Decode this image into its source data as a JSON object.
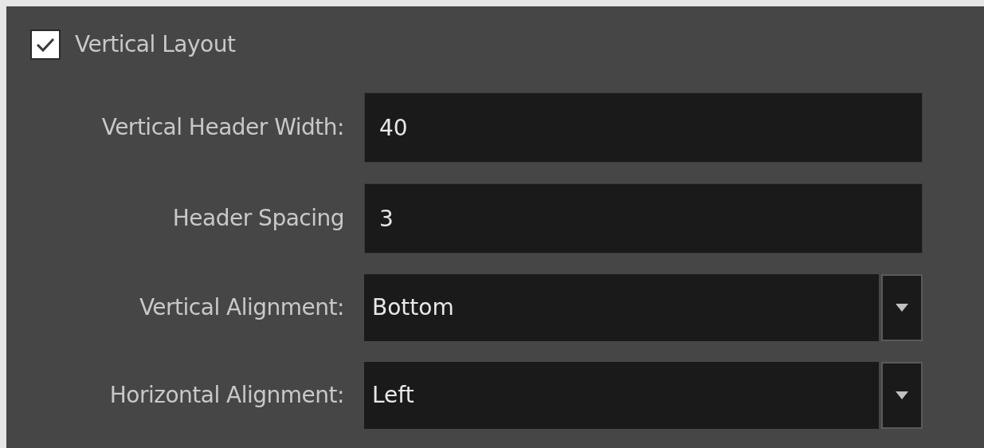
{
  "vertical_layout": {
    "label": "Vertical Layout",
    "checked": true
  },
  "fields": [
    {
      "kind": "text",
      "label": "Vertical Header Width:",
      "value": "40"
    },
    {
      "kind": "text",
      "label": "Header Spacing",
      "value": "3"
    },
    {
      "kind": "dropdown",
      "label": "Vertical Alignment:",
      "value": "Bottom"
    },
    {
      "kind": "dropdown",
      "label": "Horizontal Alignment:",
      "value": "Left"
    }
  ]
}
